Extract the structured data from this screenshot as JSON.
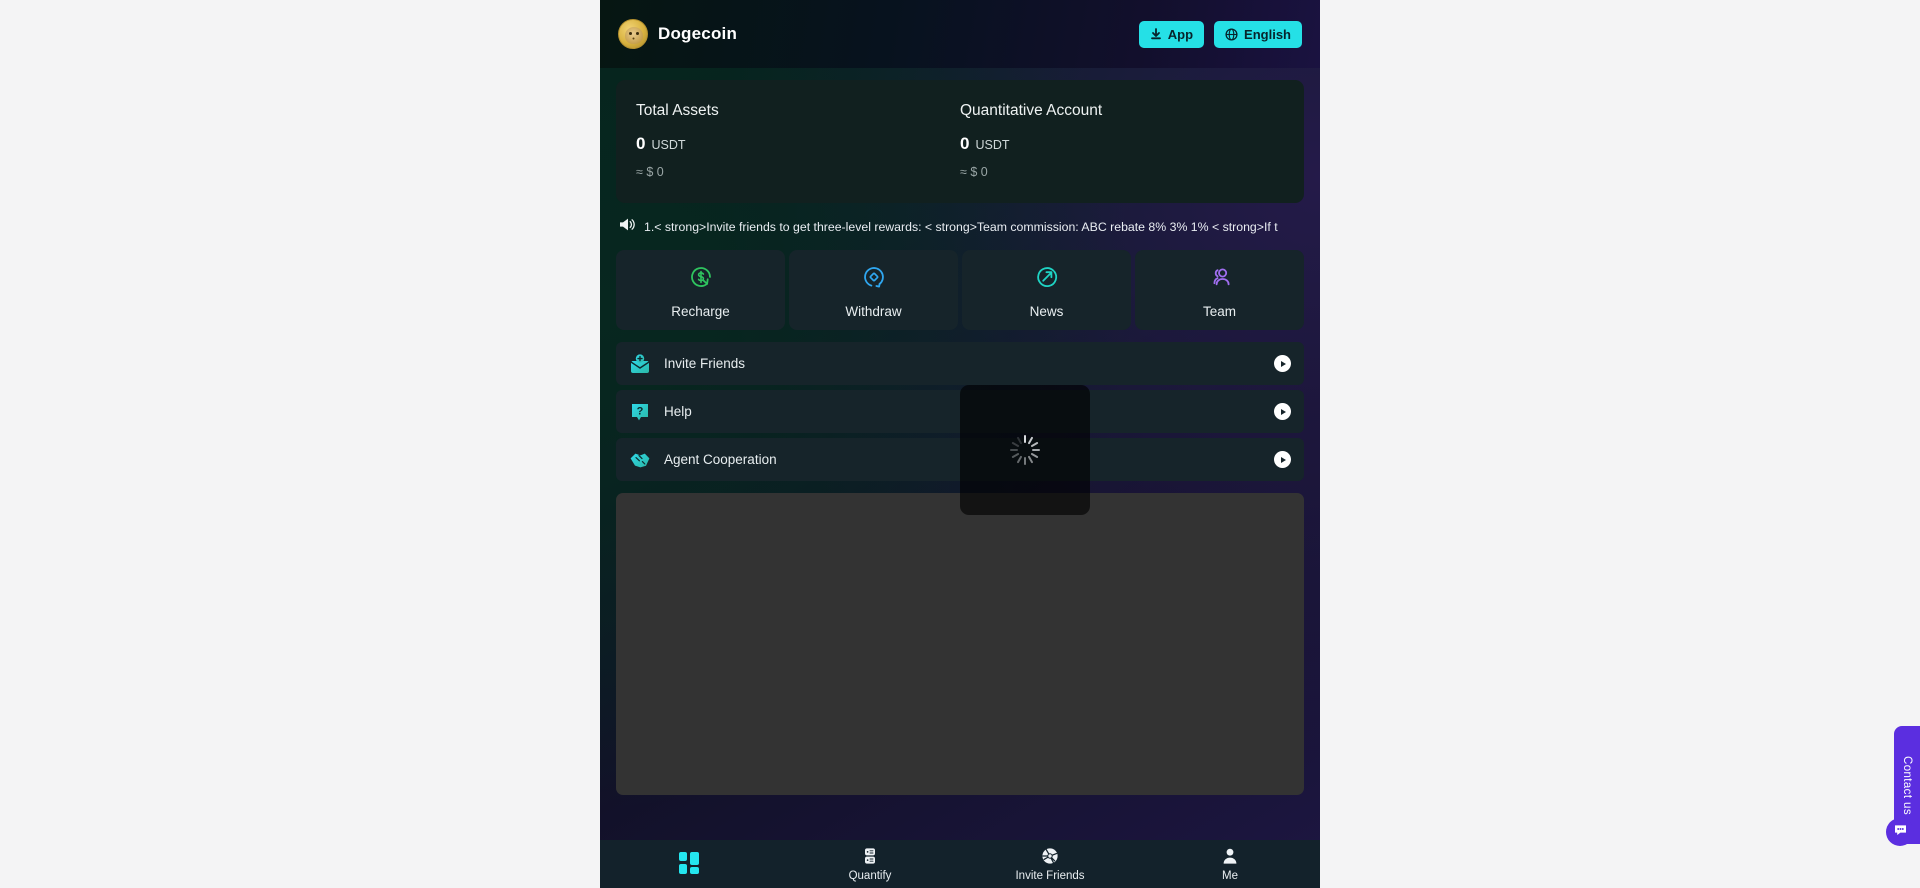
{
  "header": {
    "brand": "Dogecoin",
    "logo_icon": "dogecoin-coin-icon",
    "app_button": {
      "label": "App",
      "icon": "download-icon"
    },
    "language_button": {
      "label": "English",
      "icon": "globe-icon"
    },
    "accent_color": "#25e0e6"
  },
  "assets": {
    "total": {
      "title": "Total Assets",
      "amount": "0",
      "unit": "USDT",
      "approx": "≈ $ 0"
    },
    "quant": {
      "title": "Quantitative Account",
      "amount": "0",
      "unit": "USDT",
      "approx": "≈ $ 0"
    }
  },
  "announcement": {
    "icon": "megaphone-icon",
    "text": "1.< strong>Invite friends to get three-level rewards: < strong>Team commission: ABC rebate 8% 3% 1% < strong>If t"
  },
  "tiles": [
    {
      "label": "Recharge",
      "icon": "dollar-circle-icon",
      "color": "#2fc45f"
    },
    {
      "label": "Withdraw",
      "icon": "location-pin-circle-icon",
      "color": "#2fa7f0"
    },
    {
      "label": "News",
      "icon": "arrow-up-right-circle-icon",
      "color": "#1fd4c4"
    },
    {
      "label": "Team",
      "icon": "people-icon",
      "color": "#a06ef0"
    }
  ],
  "rows": [
    {
      "label": "Invite Friends",
      "icon": "envelope-plus-icon",
      "chevron": "chevron-right-icon"
    },
    {
      "label": "Help",
      "icon": "question-bubble-icon",
      "chevron": "chevron-right-icon"
    },
    {
      "label": "Agent Cooperation",
      "icon": "handshake-icon",
      "chevron": "chevron-right-icon"
    }
  ],
  "overlay": {
    "icon": "loading-spinner-icon"
  },
  "bottom_nav": [
    {
      "label": "",
      "icon": "grid-home-icon",
      "active": true
    },
    {
      "label": "Quantify",
      "icon": "server-icon",
      "active": false
    },
    {
      "label": "Invite Friends",
      "icon": "aperture-icon",
      "active": false
    },
    {
      "label": "Me",
      "icon": "person-icon",
      "active": false
    }
  ],
  "contact_widget": {
    "label": "Contact us",
    "icon": "chat-bubble-icon",
    "color": "#5b2ee0"
  }
}
